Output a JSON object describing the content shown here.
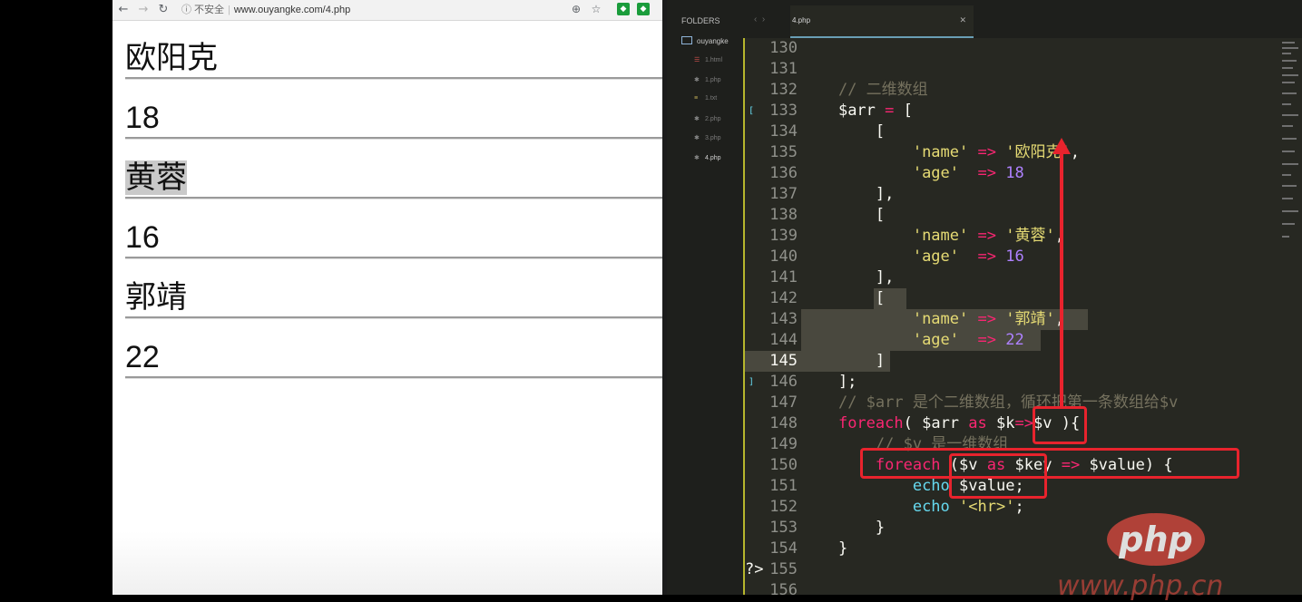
{
  "browser": {
    "security_label": "不安全",
    "url": "www.ouyangke.com/4.php",
    "output_lines": [
      "欧阳克",
      "18",
      "黄蓉",
      "16",
      "郭靖",
      "22"
    ]
  },
  "editor": {
    "sidebar_title": "FOLDERS",
    "folder_name": "ouyangke",
    "files": [
      {
        "name": "1.html",
        "icon": "html-file-icon"
      },
      {
        "name": "1.php",
        "icon": "php-file-icon"
      },
      {
        "name": "1.txt",
        "icon": "text-file-icon"
      },
      {
        "name": "2.php",
        "icon": "php-file-icon"
      },
      {
        "name": "3.php",
        "icon": "php-file-icon"
      },
      {
        "name": "4.php",
        "icon": "php-file-icon"
      }
    ],
    "active_tab": "4.php",
    "line_numbers": [
      "130",
      "131",
      "132",
      "133",
      "134",
      "135",
      "136",
      "137",
      "138",
      "139",
      "140",
      "141",
      "142",
      "143",
      "144",
      "145",
      "146",
      "147",
      "148",
      "149",
      "150",
      "151",
      "152",
      "153",
      "154",
      "155",
      "156"
    ],
    "code": {
      "l132": "// 二维数组",
      "l147": "// $arr 是个二维数组，循环把第一条数组给$v",
      "l149": "// $v 是一维数组"
    }
  },
  "watermark": {
    "logo": "php",
    "url": "www.php.cn"
  },
  "colors": {
    "annotation_red": "#e8232d",
    "editor_bg": "#272822"
  }
}
